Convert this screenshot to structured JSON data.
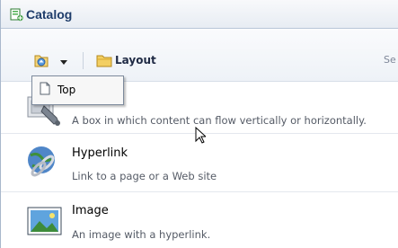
{
  "window": {
    "title": "Catalog"
  },
  "toolbar": {
    "layout_label": "Layout",
    "trailing_text": "Se"
  },
  "menu": {
    "items": [
      {
        "label": "Top",
        "icon": "page-icon"
      }
    ]
  },
  "catalog": {
    "items": [
      {
        "name": "",
        "description": "A box in which content can flow vertically or horizontally.",
        "icon": "box-tool-icon"
      },
      {
        "name": "Hyperlink",
        "description": "Link to a page or a Web site",
        "icon": "hyperlink-globe-icon"
      },
      {
        "name": "Image",
        "description": "An image with a hyperlink.",
        "icon": "image-icon"
      }
    ]
  }
}
